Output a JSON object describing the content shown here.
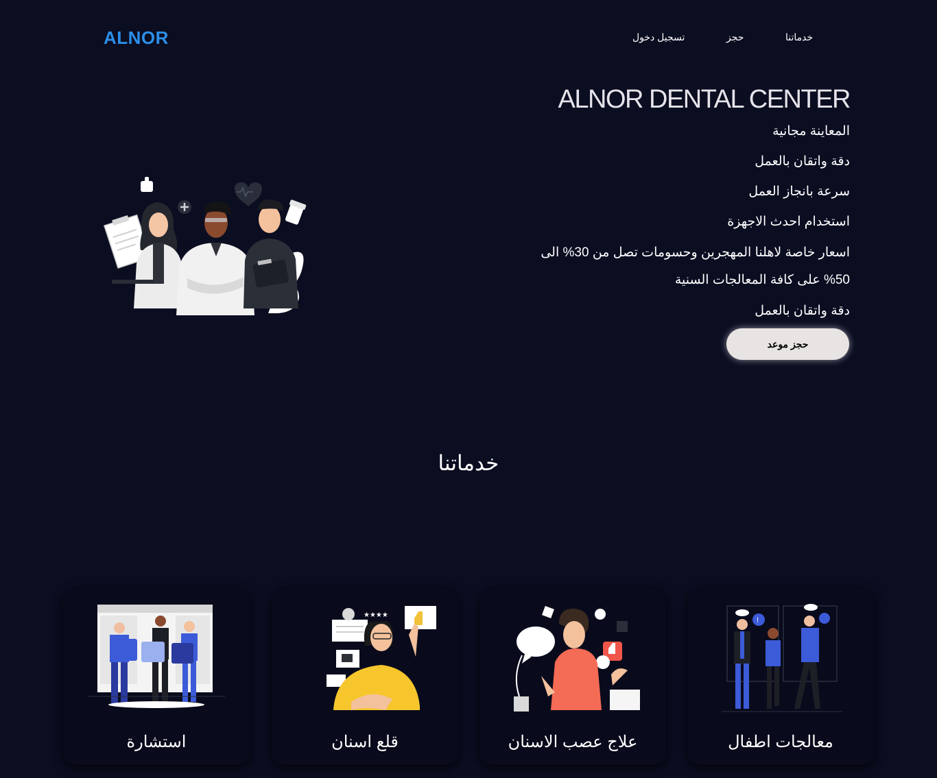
{
  "header": {
    "logo": "ALNOR",
    "nav": [
      "خدماتنا",
      "حجز",
      "تسجيل دخول"
    ]
  },
  "hero": {
    "title": "ALNOR DENTAL CENTER",
    "features": [
      "المعاينة مجانية",
      "دقة واتقان بالعمل",
      "سرعة بانجاز العمل",
      "استخدام احدث الاجهزة",
      "اسعار خاصة لاهلنا المهجرين وحسومات تصل من 30% الى 50% على كافة المعالجات السنية",
      "دقة واتقان بالعمل"
    ],
    "button": "حجز موعد",
    "illustration_icon": "doctors-team-illustration"
  },
  "services": {
    "title": "خدماتنا",
    "cards": [
      {
        "label": "معالجات اطفال",
        "icon": "business-people-illustration"
      },
      {
        "label": "علاج عصب الاسنان",
        "icon": "man-speech-bubble-illustration"
      },
      {
        "label": "قلع اسنان",
        "icon": "woman-feedback-illustration"
      },
      {
        "label": "استشارة",
        "icon": "team-puzzle-illustration"
      }
    ]
  },
  "colors": {
    "background": "#0b0d21",
    "logo": "#2b8fe8",
    "button_bg": "#e9e4e4",
    "card_bg": "#090b1c"
  }
}
